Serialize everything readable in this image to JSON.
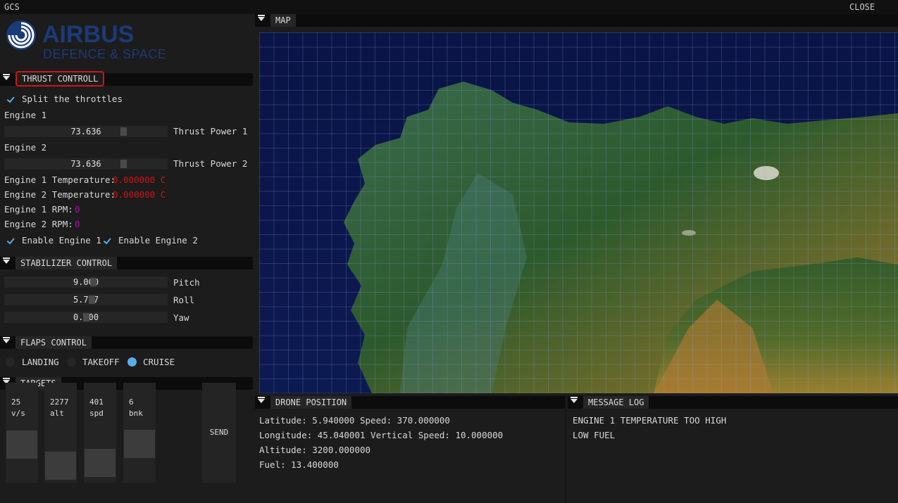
{
  "window": {
    "title": "GCS",
    "close_label": "CLOSE"
  },
  "logo": {
    "brand": "AIRBUS",
    "subtitle": "DEFENCE & SPACE",
    "brand_color": "#1b3a78"
  },
  "thrust": {
    "header": "THRUST CONTROLL",
    "split_label": "Split the throttles",
    "engine1_label": "Engine 1",
    "engine1_value": "73.636",
    "engine1_power_label": "Thrust Power 1",
    "engine2_label": "Engine 2",
    "engine2_value": "73.636",
    "engine2_power_label": "Thrust Power 2",
    "temp1_label": "Engine 1 Temperature:",
    "temp1_value": "0.000000 C",
    "temp2_label": "Engine 2 Temperature:",
    "temp2_value": "0.000000 C",
    "rpm1_label": "Engine 1 RPM:",
    "rpm1_value": "0",
    "rpm2_label": "Engine 2 RPM:",
    "rpm2_value": "0",
    "enable1_label": "Enable Engine 1",
    "enable2_label": "Enable Engine 2"
  },
  "stabilizer": {
    "header": "STABILIZER CONTROL",
    "pitch_value": "9.000",
    "pitch_label": "Pitch",
    "roll_value": "5.727",
    "roll_label": "Roll",
    "yaw_value": "0.000",
    "yaw_label": "Yaw"
  },
  "flaps": {
    "header": "FLAPS CONTROL",
    "options": [
      "LANDING",
      "TAKEOFF",
      "CRUISE"
    ],
    "selected": "CRUISE"
  },
  "targets": {
    "header": "TARGETS",
    "vs_value": "25",
    "vs_unit": "v/s",
    "alt_value": "2277",
    "alt_unit": "alt",
    "spd_value": "401",
    "spd_unit": "spd",
    "bnk_value": "6",
    "bnk_unit": "bnk",
    "send_label": "SEND"
  },
  "map": {
    "header": "MAP"
  },
  "drone": {
    "header": "DRONE POSITION",
    "line1": "Latitude: 5.940000 Speed: 370.000000",
    "line2": "Longitude: 45.040001 Vertical Speed: 10.000000",
    "line3": "Altitude: 3200.000000",
    "line4": "Fuel: 13.400000"
  },
  "log": {
    "header": "MESSAGE LOG",
    "msg1": "ENGINE 1 TEMPERATURE TOO HIGH",
    "msg2": "LOW FUEL"
  }
}
